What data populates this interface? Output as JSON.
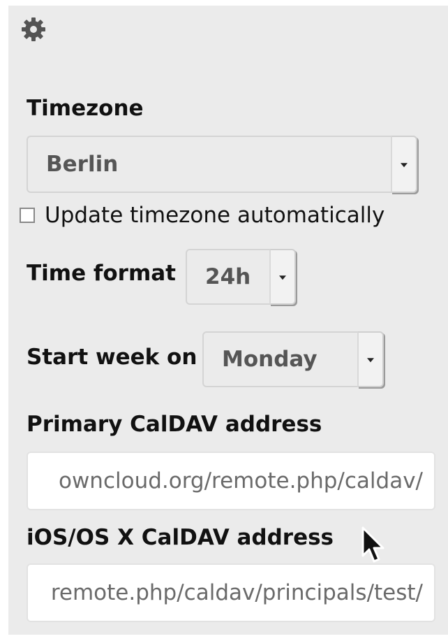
{
  "settings": {
    "gear_icon": "gear-icon",
    "timezone": {
      "label": "Timezone",
      "value": "Berlin"
    },
    "auto_timezone": {
      "label": "Update timezone automatically",
      "checked": false
    },
    "time_format": {
      "label": "Time format",
      "value": "24h"
    },
    "start_week": {
      "label": "Start week on",
      "value": "Monday"
    },
    "primary_caldav": {
      "label": "Primary CalDAV address",
      "value": "owncloud.org/remote.php/caldav/"
    },
    "ios_caldav": {
      "label": "iOS/OS X CalDAV address",
      "value": "remote.php/caldav/principals/test/"
    }
  },
  "colors": {
    "panel_background": "#ebebeb",
    "text": "#111111",
    "muted_text": "#555555"
  }
}
